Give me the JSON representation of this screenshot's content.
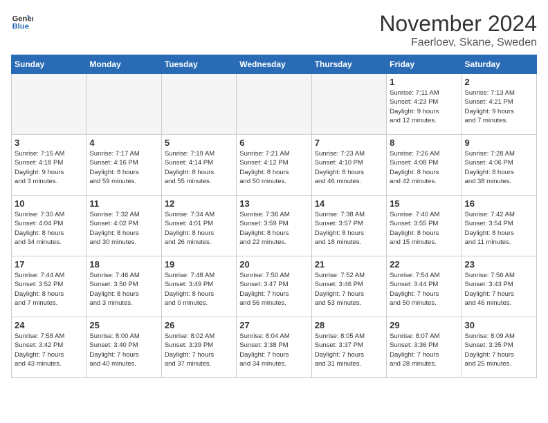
{
  "header": {
    "logo_line1": "General",
    "logo_line2": "Blue",
    "month_title": "November 2024",
    "location": "Faerloev, Skane, Sweden"
  },
  "days_of_week": [
    "Sunday",
    "Monday",
    "Tuesday",
    "Wednesday",
    "Thursday",
    "Friday",
    "Saturday"
  ],
  "weeks": [
    [
      {
        "day": "",
        "info": "",
        "empty": true
      },
      {
        "day": "",
        "info": "",
        "empty": true
      },
      {
        "day": "",
        "info": "",
        "empty": true
      },
      {
        "day": "",
        "info": "",
        "empty": true
      },
      {
        "day": "",
        "info": "",
        "empty": true
      },
      {
        "day": "1",
        "info": "Sunrise: 7:11 AM\nSunset: 4:23 PM\nDaylight: 9 hours\nand 12 minutes."
      },
      {
        "day": "2",
        "info": "Sunrise: 7:13 AM\nSunset: 4:21 PM\nDaylight: 9 hours\nand 7 minutes."
      }
    ],
    [
      {
        "day": "3",
        "info": "Sunrise: 7:15 AM\nSunset: 4:18 PM\nDaylight: 9 hours\nand 3 minutes."
      },
      {
        "day": "4",
        "info": "Sunrise: 7:17 AM\nSunset: 4:16 PM\nDaylight: 8 hours\nand 59 minutes."
      },
      {
        "day": "5",
        "info": "Sunrise: 7:19 AM\nSunset: 4:14 PM\nDaylight: 8 hours\nand 55 minutes."
      },
      {
        "day": "6",
        "info": "Sunrise: 7:21 AM\nSunset: 4:12 PM\nDaylight: 8 hours\nand 50 minutes."
      },
      {
        "day": "7",
        "info": "Sunrise: 7:23 AM\nSunset: 4:10 PM\nDaylight: 8 hours\nand 46 minutes."
      },
      {
        "day": "8",
        "info": "Sunrise: 7:26 AM\nSunset: 4:08 PM\nDaylight: 8 hours\nand 42 minutes."
      },
      {
        "day": "9",
        "info": "Sunrise: 7:28 AM\nSunset: 4:06 PM\nDaylight: 8 hours\nand 38 minutes."
      }
    ],
    [
      {
        "day": "10",
        "info": "Sunrise: 7:30 AM\nSunset: 4:04 PM\nDaylight: 8 hours\nand 34 minutes."
      },
      {
        "day": "11",
        "info": "Sunrise: 7:32 AM\nSunset: 4:02 PM\nDaylight: 8 hours\nand 30 minutes."
      },
      {
        "day": "12",
        "info": "Sunrise: 7:34 AM\nSunset: 4:01 PM\nDaylight: 8 hours\nand 26 minutes."
      },
      {
        "day": "13",
        "info": "Sunrise: 7:36 AM\nSunset: 3:59 PM\nDaylight: 8 hours\nand 22 minutes."
      },
      {
        "day": "14",
        "info": "Sunrise: 7:38 AM\nSunset: 3:57 PM\nDaylight: 8 hours\nand 18 minutes."
      },
      {
        "day": "15",
        "info": "Sunrise: 7:40 AM\nSunset: 3:55 PM\nDaylight: 8 hours\nand 15 minutes."
      },
      {
        "day": "16",
        "info": "Sunrise: 7:42 AM\nSunset: 3:54 PM\nDaylight: 8 hours\nand 11 minutes."
      }
    ],
    [
      {
        "day": "17",
        "info": "Sunrise: 7:44 AM\nSunset: 3:52 PM\nDaylight: 8 hours\nand 7 minutes."
      },
      {
        "day": "18",
        "info": "Sunrise: 7:46 AM\nSunset: 3:50 PM\nDaylight: 8 hours\nand 3 minutes."
      },
      {
        "day": "19",
        "info": "Sunrise: 7:48 AM\nSunset: 3:49 PM\nDaylight: 8 hours\nand 0 minutes."
      },
      {
        "day": "20",
        "info": "Sunrise: 7:50 AM\nSunset: 3:47 PM\nDaylight: 7 hours\nand 56 minutes."
      },
      {
        "day": "21",
        "info": "Sunrise: 7:52 AM\nSunset: 3:46 PM\nDaylight: 7 hours\nand 53 minutes."
      },
      {
        "day": "22",
        "info": "Sunrise: 7:54 AM\nSunset: 3:44 PM\nDaylight: 7 hours\nand 50 minutes."
      },
      {
        "day": "23",
        "info": "Sunrise: 7:56 AM\nSunset: 3:43 PM\nDaylight: 7 hours\nand 46 minutes."
      }
    ],
    [
      {
        "day": "24",
        "info": "Sunrise: 7:58 AM\nSunset: 3:42 PM\nDaylight: 7 hours\nand 43 minutes."
      },
      {
        "day": "25",
        "info": "Sunrise: 8:00 AM\nSunset: 3:40 PM\nDaylight: 7 hours\nand 40 minutes."
      },
      {
        "day": "26",
        "info": "Sunrise: 8:02 AM\nSunset: 3:39 PM\nDaylight: 7 hours\nand 37 minutes."
      },
      {
        "day": "27",
        "info": "Sunrise: 8:04 AM\nSunset: 3:38 PM\nDaylight: 7 hours\nand 34 minutes."
      },
      {
        "day": "28",
        "info": "Sunrise: 8:05 AM\nSunset: 3:37 PM\nDaylight: 7 hours\nand 31 minutes."
      },
      {
        "day": "29",
        "info": "Sunrise: 8:07 AM\nSunset: 3:36 PM\nDaylight: 7 hours\nand 28 minutes."
      },
      {
        "day": "30",
        "info": "Sunrise: 8:09 AM\nSunset: 3:35 PM\nDaylight: 7 hours\nand 25 minutes."
      }
    ]
  ]
}
